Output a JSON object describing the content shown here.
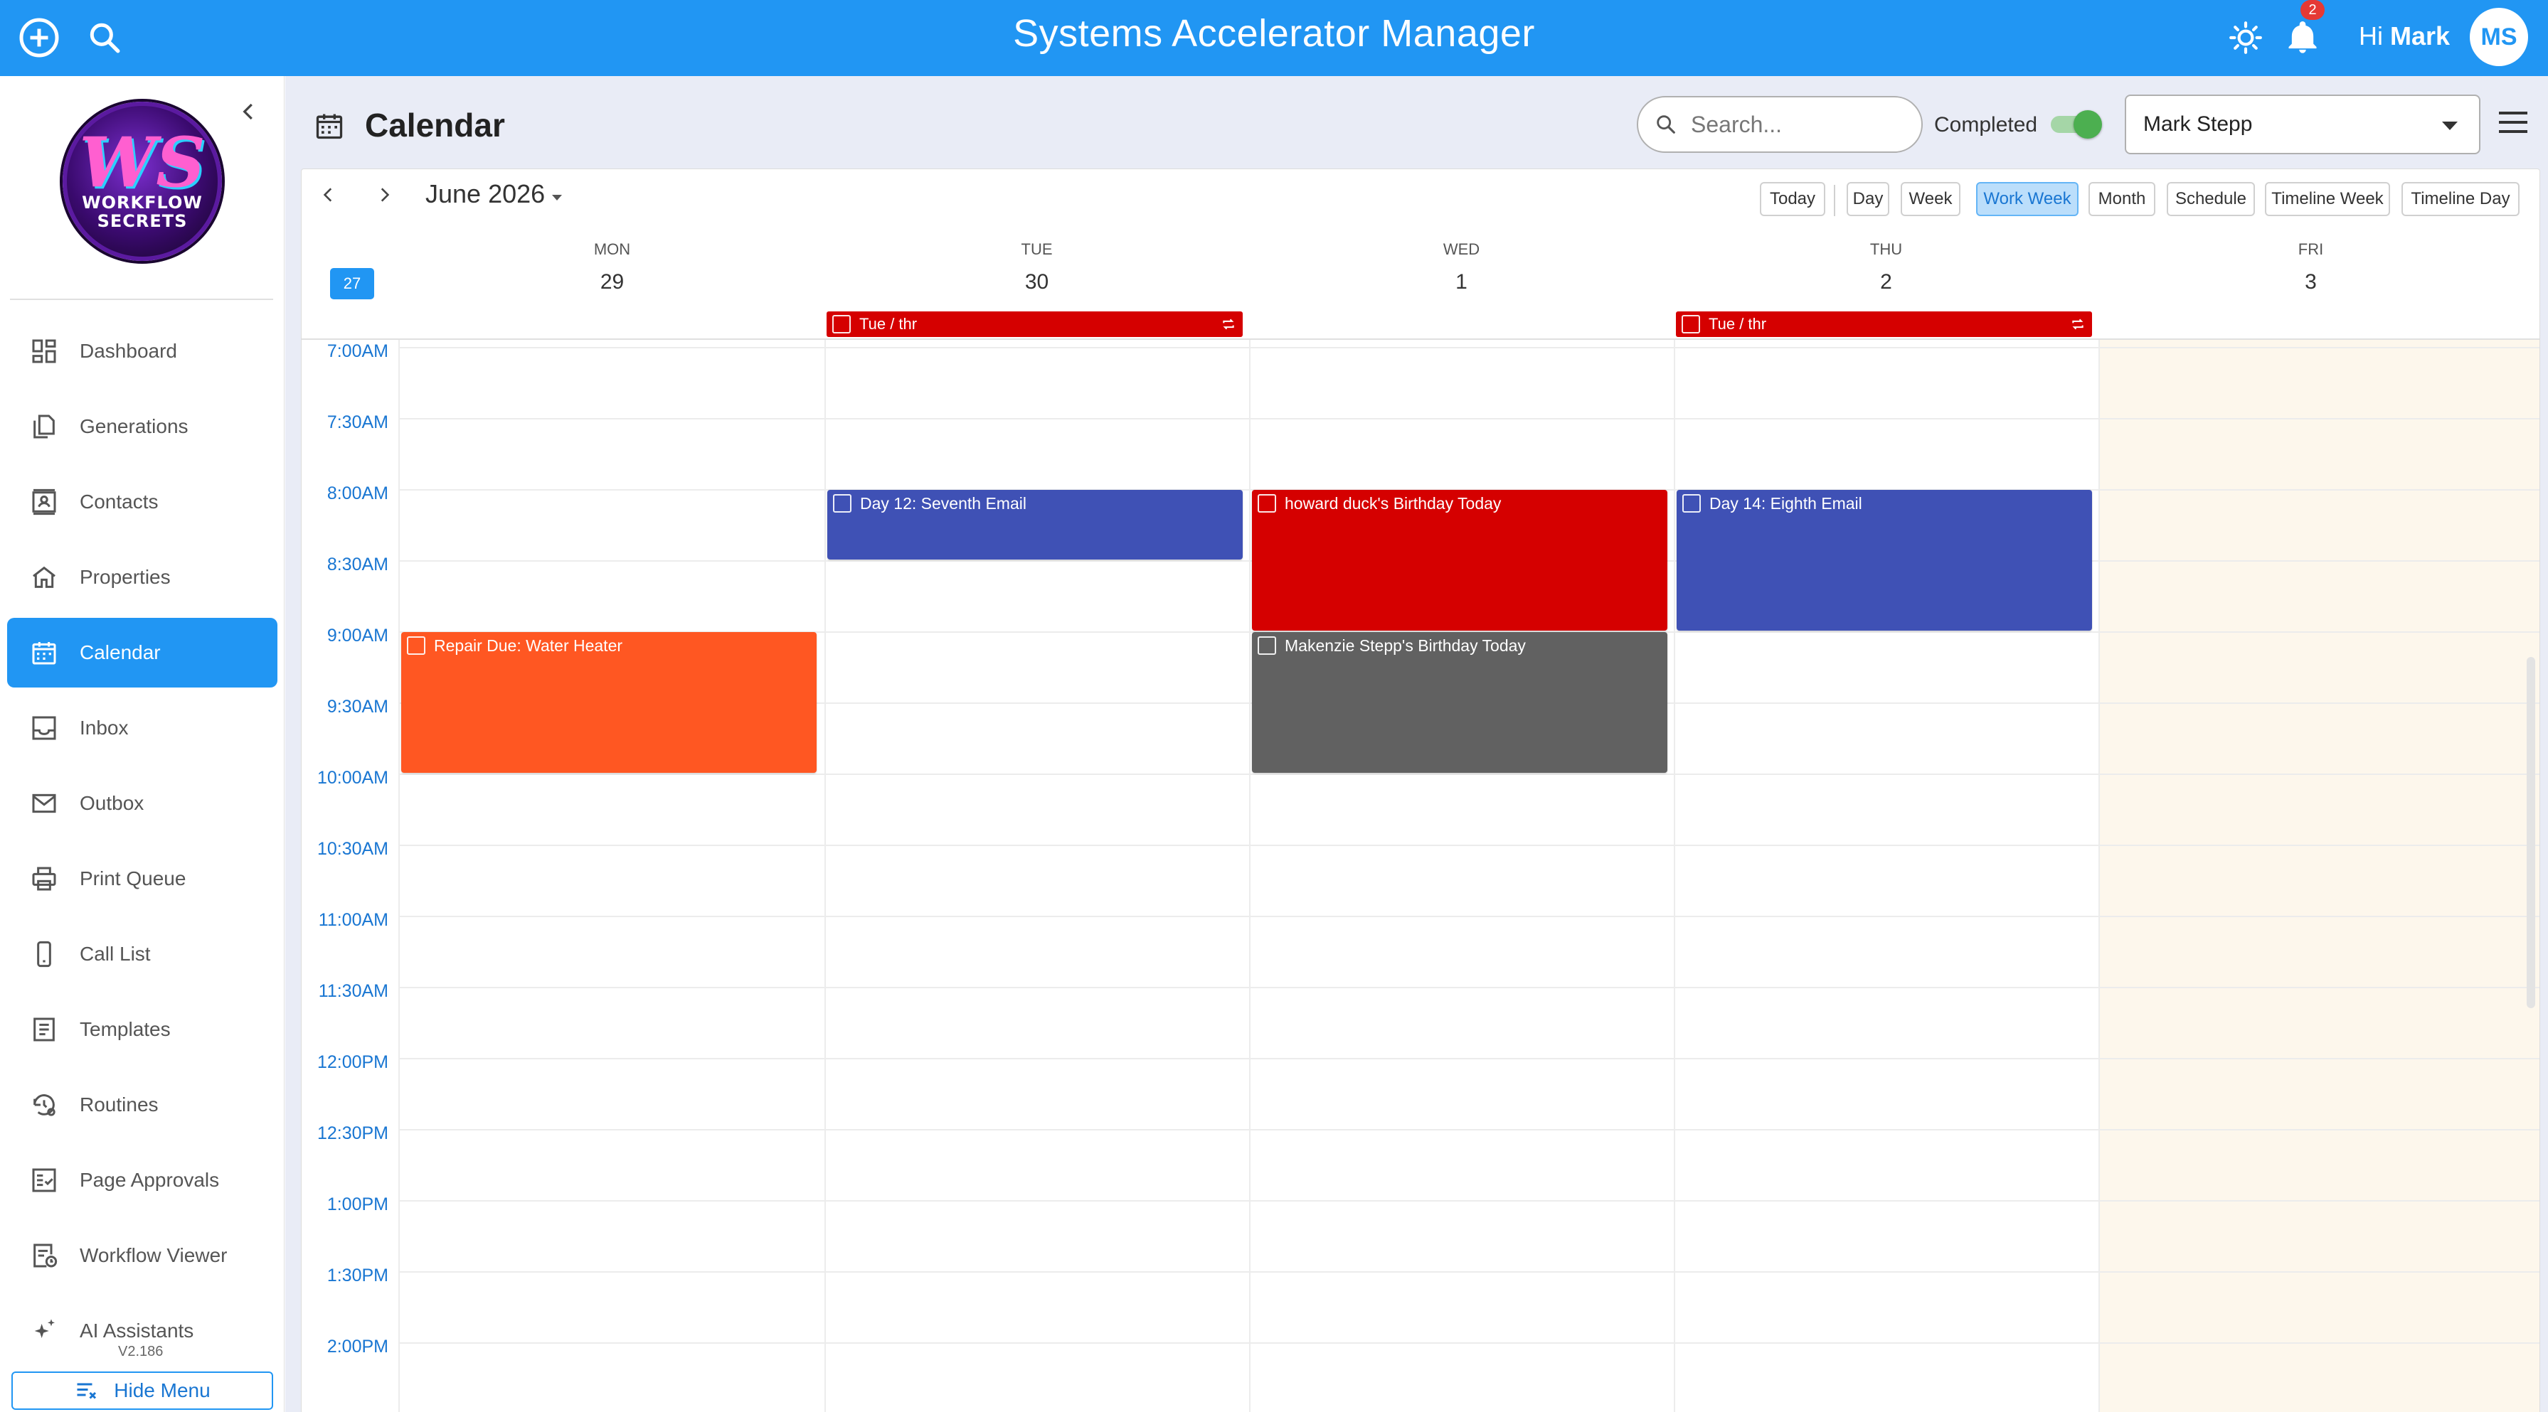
{
  "app": {
    "title": "Systems Accelerator Manager",
    "greeting_prefix": "Hi",
    "user_first_name": "Mark",
    "avatar_initials": "MS",
    "notification_count": "2",
    "brand_color": "#2196f3"
  },
  "sidebar": {
    "logo": {
      "mark": "WS",
      "line1": "WORKFLOW",
      "line2": "SECRETS"
    },
    "items": [
      {
        "label": "Dashboard",
        "icon": "dashboard-icon"
      },
      {
        "label": "Generations",
        "icon": "copy-icon"
      },
      {
        "label": "Contacts",
        "icon": "contact-card-icon"
      },
      {
        "label": "Properties",
        "icon": "home-icon"
      },
      {
        "label": "Calendar",
        "icon": "calendar-icon",
        "active": true
      },
      {
        "label": "Inbox",
        "icon": "inbox-icon"
      },
      {
        "label": "Outbox",
        "icon": "mail-icon"
      },
      {
        "label": "Print Queue",
        "icon": "printer-icon"
      },
      {
        "label": "Call List",
        "icon": "phone-icon"
      },
      {
        "label": "Templates",
        "icon": "document-icon"
      },
      {
        "label": "Routines",
        "icon": "history-gear-icon"
      },
      {
        "label": "Page Approvals",
        "icon": "checklist-icon"
      },
      {
        "label": "Workflow Viewer",
        "icon": "document-clock-icon"
      },
      {
        "label": "AI Assistants",
        "icon": "sparkle-icon"
      }
    ],
    "version": "V2.186",
    "hide_menu_label": "Hide Menu"
  },
  "page": {
    "title": "Calendar",
    "search_placeholder": "Search...",
    "completed_label": "Completed",
    "completed_on": true,
    "selected_user": "Mark Stepp"
  },
  "calendar": {
    "month_label": "June 2026",
    "week_number": "27",
    "views": [
      "Today",
      "Day",
      "Week",
      "Work Week",
      "Month",
      "Schedule",
      "Timeline Week",
      "Timeline Day"
    ],
    "active_view": "Work Week",
    "days": [
      {
        "name": "MON",
        "date": "29"
      },
      {
        "name": "TUE",
        "date": "30"
      },
      {
        "name": "WED",
        "date": "1"
      },
      {
        "name": "THU",
        "date": "2"
      },
      {
        "name": "FRI",
        "date": "3"
      }
    ],
    "time_slots": [
      "7:00AM",
      "7:30AM",
      "8:00AM",
      "8:30AM",
      "9:00AM",
      "9:30AM",
      "10:00AM",
      "10:30AM",
      "11:00AM",
      "11:30AM",
      "12:00PM",
      "12:30PM",
      "1:00PM",
      "1:30PM",
      "2:00PM"
    ],
    "all_day_events": [
      {
        "title": "Tue / thr",
        "day": "TUE",
        "color": "#d50000",
        "recurring": true
      },
      {
        "title": "Tue / thr",
        "day": "THU",
        "color": "#d50000",
        "recurring": true
      }
    ],
    "events": [
      {
        "title": "Day 12: Seventh Email",
        "day": "TUE",
        "start": "8:00AM",
        "end": "8:30AM",
        "color": "#3f51b5"
      },
      {
        "title": "howard duck's Birthday Today",
        "day": "WED",
        "start": "8:00AM",
        "end": "9:00AM",
        "color": "#d50000"
      },
      {
        "title": "Day 14: Eighth Email",
        "day": "THU",
        "start": "8:00AM",
        "end": "9:00AM",
        "color": "#3f51b5"
      },
      {
        "title": "Repair Due: Water Heater",
        "day": "MON",
        "start": "9:00AM",
        "end": "10:00AM",
        "color": "#ff5722"
      },
      {
        "title": "Makenzie Stepp's Birthday Today",
        "day": "WED",
        "start": "9:00AM",
        "end": "10:00AM",
        "color": "#616161"
      }
    ]
  }
}
